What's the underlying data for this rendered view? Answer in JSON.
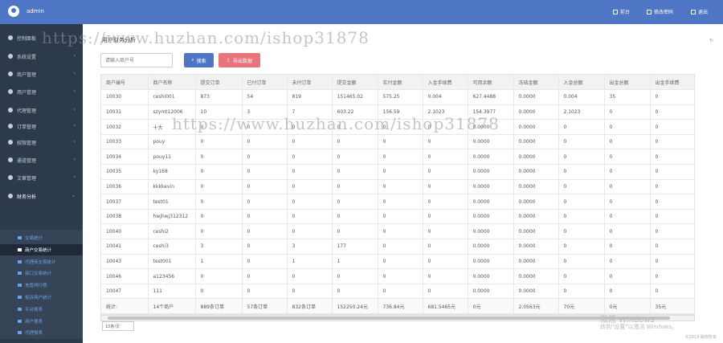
{
  "header": {
    "username": "admin",
    "links": [
      "前台",
      "修改密码",
      "退出"
    ]
  },
  "sidebar": {
    "items": [
      {
        "label": "控制面板",
        "arrow": ""
      },
      {
        "label": "系统设置",
        "arrow": "‹"
      },
      {
        "label": "商户管理",
        "arrow": "‹"
      },
      {
        "label": "用户管理",
        "arrow": "‹"
      },
      {
        "label": "代理管理",
        "arrow": "‹"
      },
      {
        "label": "订单管理",
        "arrow": "‹"
      },
      {
        "label": "权限管理",
        "arrow": "‹"
      },
      {
        "label": "通道管理",
        "arrow": "‹"
      },
      {
        "label": "文章管理",
        "arrow": "‹"
      },
      {
        "label": "财务分析",
        "arrow": "⌄"
      },
      {
        "label": "其他设置",
        "arrow": "‹"
      }
    ],
    "submenu": [
      "交易统计",
      "商户交易统计",
      "代理商交易统计",
      "接口交易统计",
      "充值排行榜",
      "投诉商户统计",
      "平台报表",
      "商户报表",
      "代理报表"
    ],
    "active_sub": 1
  },
  "page": {
    "title": "用户财务分析",
    "corner": "↻",
    "search_placeholder": "请输入商户号",
    "search_button": "搜索",
    "export_button": "导出数据",
    "copyright": "©2019 版权所有"
  },
  "table": {
    "headers": [
      "商户编号",
      "商户名称",
      "提交订单",
      "已付订单",
      "未付订单",
      "提交金额",
      "实付金额",
      "入金手续费",
      "可用余额",
      "冻结金额",
      "入金总额",
      "出金总额",
      "出金手续费"
    ],
    "rows": [
      [
        "10030",
        "ceshi001",
        "873",
        "54",
        "819",
        "151465.02",
        "575.25",
        "0.004",
        "627.4488",
        "0.0000",
        "0.004",
        "35",
        "0"
      ],
      [
        "10031",
        "szymt12006",
        "10",
        "3",
        "7",
        "603.22",
        "156.59",
        "2.1023",
        "154.3977",
        "0.0000",
        "2.1023",
        "0",
        "0"
      ],
      [
        "10032",
        "十大",
        "0",
        "0",
        "0",
        "0",
        "0",
        "0",
        "0.0000",
        "0.0000",
        "0",
        "0",
        "0"
      ],
      [
        "10033",
        "pouy",
        "0",
        "0",
        "0",
        "0",
        "0",
        "0",
        "0.0000",
        "0.0000",
        "0",
        "0",
        "0"
      ],
      [
        "10034",
        "pouy11",
        "0",
        "0",
        "0",
        "0",
        "0",
        "0",
        "0.0000",
        "0.0000",
        "0",
        "0",
        "0"
      ],
      [
        "10035",
        "ky168",
        "0",
        "0",
        "0",
        "0",
        "0",
        "0",
        "0.0000",
        "0.0000",
        "0",
        "0",
        "0"
      ],
      [
        "10036",
        "kkkkevin",
        "0",
        "0",
        "0",
        "0",
        "0",
        "0",
        "0.0000",
        "0.0000",
        "0",
        "0",
        "0"
      ],
      [
        "10037",
        "test01",
        "0",
        "0",
        "0",
        "0",
        "0",
        "0",
        "0.0000",
        "0.0000",
        "0",
        "0",
        "0"
      ],
      [
        "10038",
        "hwjhwj312312",
        "0",
        "0",
        "0",
        "0",
        "0",
        "0",
        "0.0000",
        "0.0000",
        "0",
        "0",
        "0"
      ],
      [
        "10040",
        "ceshi2",
        "0",
        "0",
        "0",
        "0",
        "0",
        "0",
        "0.0000",
        "0.0000",
        "0",
        "0",
        "0"
      ],
      [
        "10041",
        "ceshi3",
        "3",
        "0",
        "3",
        "177",
        "0",
        "0",
        "0.0000",
        "0.0000",
        "0",
        "0",
        "0"
      ],
      [
        "10043",
        "test001",
        "1",
        "0",
        "1",
        "1",
        "0",
        "0",
        "0.0000",
        "0.0000",
        "0",
        "0",
        "0"
      ],
      [
        "10046",
        "a123456",
        "0",
        "0",
        "0",
        "0",
        "0",
        "0",
        "0.0000",
        "0.0000",
        "0",
        "0",
        "0"
      ],
      [
        "10047",
        "111",
        "0",
        "0",
        "0",
        "0",
        "0",
        "0",
        "0.0000",
        "0.0000",
        "0",
        "0",
        "0"
      ]
    ],
    "total": [
      "统计:",
      "14个商户",
      "889条订单",
      "57条订单",
      "832条订单",
      "152250.24元",
      "736.84元",
      "681.5465元",
      "0元",
      "2.0563元",
      "70元",
      "0元",
      "35元"
    ]
  },
  "pager": {
    "label": "10条/页"
  },
  "watermark": "https://www.huzhan.com/ishop31878",
  "activation": {
    "line1": "激活 Windows",
    "line2": "转到\"设置\"以激活 Windows。"
  }
}
